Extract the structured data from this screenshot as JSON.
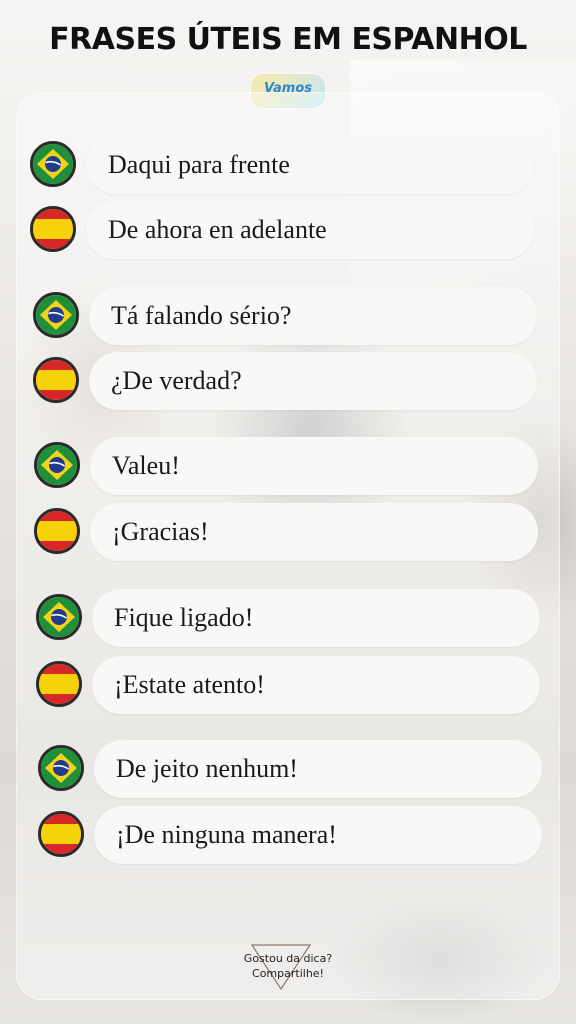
{
  "title": "FRASES ÚTEIS EM ESPANHOL",
  "logo": {
    "text": "Vamos"
  },
  "pairs": [
    {
      "pt": "Daqui para frente",
      "es": "De ahora en adelante"
    },
    {
      "pt": "Tá falando sério?",
      "es": "¿De verdad?"
    },
    {
      "pt": "Valeu!",
      "es": "¡Gracias!"
    },
    {
      "pt": "Fique ligado!",
      "es": "¡Estate atento!"
    },
    {
      "pt": "De jeito nenhum!",
      "es": "¡De ninguna manera!"
    }
  ],
  "footer": {
    "line1": "Gostou da dica?",
    "line2": "Compartilhe!"
  },
  "icons": {
    "pt_flag": "brazil-flag-icon",
    "es_flag": "spain-flag-icon"
  },
  "colors": {
    "brazil_green": "#1f8f3a",
    "brazil_yellow": "#f2d21b",
    "brazil_blue": "#1f3d8a",
    "spain_red": "#d62828",
    "spain_yellow": "#f5d20a"
  }
}
